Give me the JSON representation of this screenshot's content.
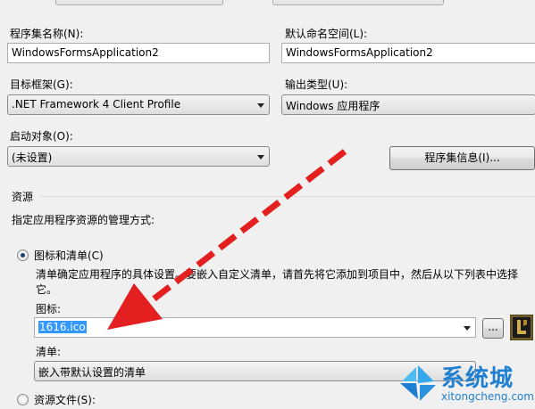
{
  "assembly_name": {
    "label": "程序集名称(N):",
    "value": "WindowsFormsApplication2"
  },
  "default_namespace": {
    "label": "默认命名空间(L):",
    "value": "WindowsFormsApplication2"
  },
  "target_framework": {
    "label": "目标框架(G):",
    "value": ".NET Framework 4 Client Profile"
  },
  "output_type": {
    "label": "输出类型(U):",
    "value": "Windows 应用程序"
  },
  "startup_object": {
    "label": "启动对象(O):",
    "value": "(未设置)"
  },
  "assembly_info_button": "程序集信息(I)...",
  "resources": {
    "group_title": "资源",
    "description": "指定应用程序资源的管理方式:",
    "icon_and_manifest": {
      "label": "图标和清单(C)",
      "selected": true,
      "help_line1": "清单确定应用程序的具体设置。要嵌入自定义清单，请首先将它添加到项目中，然后从以下列表中选择",
      "help_line2": "它。",
      "icon_label": "图标:",
      "icon_value": "1616.ico",
      "browse_button": "...",
      "manifest_label": "清单:",
      "manifest_value": "嵌入带默认设置的清单"
    },
    "resource_file": {
      "label": "资源文件(S):",
      "selected": false
    }
  },
  "watermark": {
    "brand": "系统城",
    "site": "xitongcheng.com"
  },
  "colors": {
    "arrow": "#e41f1f",
    "selection": "#3399ff",
    "watermark_blue": "#1f7fd0"
  }
}
